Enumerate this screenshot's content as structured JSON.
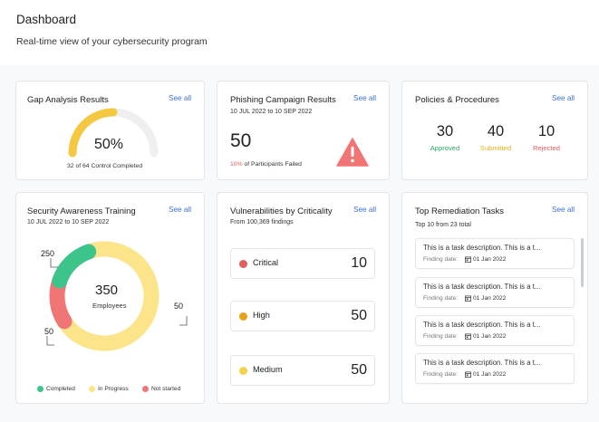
{
  "header": {
    "title": "Dashboard",
    "subtitle": "Real-time view of your cybersecurity program"
  },
  "colors": {
    "accent": "#3b6fd8",
    "yellow": "#f5c842",
    "green": "#3cc48a",
    "red": "#f07575",
    "orange": "#e8a21a",
    "completed": "#3cc48a",
    "in_progress": "#fbe48a",
    "not_started": "#f07575"
  },
  "gap": {
    "title": "Gap Analysis Results",
    "see_all": "See all",
    "percent_label": "50%",
    "progress": 0.5,
    "caption": "32 of 64 Control Completed"
  },
  "phishing": {
    "title": "Phishing Campaign Results",
    "see_all": "See all",
    "date": "10 JUL 2022 to 10 SEP 2022",
    "value": "50",
    "percent": "10%",
    "caption": " of Participants Failed",
    "icon": "warning-icon"
  },
  "policies": {
    "title": "Policies & Procedures",
    "see_all": "See all",
    "stats": [
      {
        "value": "30",
        "label": "Approved",
        "color": "#2fa86a"
      },
      {
        "value": "40",
        "label": "Submitted",
        "color": "#e8b020"
      },
      {
        "value": "10",
        "label": "Rejected",
        "color": "#e25d5d"
      }
    ]
  },
  "awareness": {
    "title": "Security Awareness Training",
    "see_all": "See all",
    "date": "10 JUL 2022 to 10 SEP 2022",
    "total": "350",
    "total_label": "Employees",
    "segments": [
      {
        "name": "In Progress",
        "value": 250,
        "label": "250"
      },
      {
        "name": "Not started",
        "value": 50,
        "label": "50"
      },
      {
        "name": "Completed",
        "value": 50,
        "label": "50"
      }
    ],
    "legend": [
      "Completed",
      "In Progress",
      "Not started"
    ]
  },
  "vulnerabilities": {
    "title": "Vulnerabilities by Criticality",
    "see_all": "See all",
    "subtitle": "From 100,369 findings",
    "items": [
      {
        "label": "Critical",
        "value": "10",
        "color": "#e25d5d"
      },
      {
        "label": "High",
        "value": "50",
        "color": "#e8a21a"
      },
      {
        "label": "Medium",
        "value": "50",
        "color": "#f5d24a"
      }
    ]
  },
  "remediation": {
    "title": "Top Remediation Tasks",
    "see_all": "See all",
    "subtitle": "Top 10 from 23 total",
    "date_label": "Finding date:",
    "tasks": [
      {
        "desc": "This is a task description. This is a t...",
        "date": "01 Jan 2022"
      },
      {
        "desc": "This is a task description. This is a t...",
        "date": "01 Jan 2022"
      },
      {
        "desc": "This is a task description. This is a t...",
        "date": "01 Jan 2022"
      },
      {
        "desc": "This is a task description. This is a t...",
        "date": "01 Jan 2022"
      }
    ]
  }
}
